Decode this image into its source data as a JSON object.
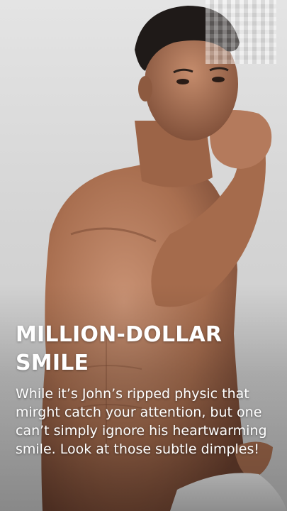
{
  "story": {
    "headline_line1": "MILLION-DOLLAR",
    "headline_line2": "SMILE",
    "body": "While it’s John’s ripped physic that mirght catch your attention, but one can’t simply ignore his heartwarming smile. Look at those subtle dimples!"
  },
  "colors": {
    "text": "#ffffff",
    "background": "#d4d4d4",
    "skin": "#b07a5a"
  }
}
